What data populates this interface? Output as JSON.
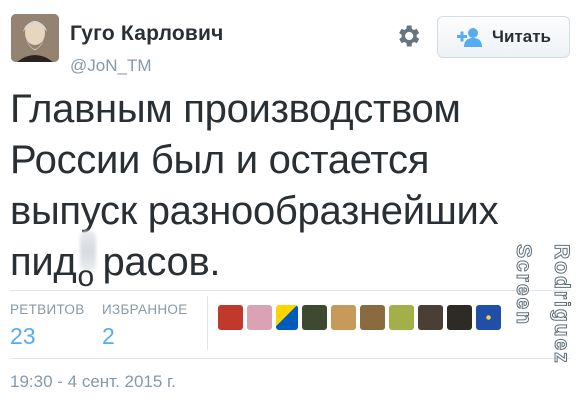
{
  "author": {
    "name": "Гуго Карлович",
    "handle": "@JoN_TM"
  },
  "actions": {
    "follow_label": "Читать"
  },
  "tweet": {
    "lines": [
      "Главным производством",
      "России был и остается",
      "выпуск разнообразнейших"
    ],
    "last_line_start": "пид",
    "censored_glyph": "о",
    "last_line_end": "расов."
  },
  "stats": {
    "retweets_label": "РЕТВИТОВ",
    "retweets_value": "23",
    "favorites_label": "ИЗБРАННОЕ",
    "favorites_value": "2"
  },
  "favoriters": [
    {
      "icon": "favoriter-avatar-1",
      "color": "#c0392b"
    },
    {
      "icon": "favoriter-avatar-2",
      "color": "#d9a3b5"
    },
    {
      "icon": "favoriter-avatar-3",
      "color": "#f1c40f"
    },
    {
      "icon": "favoriter-avatar-4",
      "color": "#3e4a2f"
    },
    {
      "icon": "favoriter-avatar-5",
      "color": "#c79a5b"
    },
    {
      "icon": "favoriter-avatar-6",
      "color": "#8a6b3f"
    },
    {
      "icon": "favoriter-avatar-7",
      "color": "#a3b04a"
    },
    {
      "icon": "favoriter-avatar-8",
      "color": "#4b3f35"
    },
    {
      "icon": "favoriter-avatar-9",
      "color": "#2e2a26"
    },
    {
      "icon": "favoriter-avatar-10",
      "color": "#1f4fa8"
    }
  ],
  "timestamp": "19:30 - 4 сент. 2015 г.",
  "watermark": "Rodriguez\nScreen",
  "colors": {
    "link_blue": "#55acee",
    "muted": "#8899a6",
    "text": "#292f33"
  }
}
